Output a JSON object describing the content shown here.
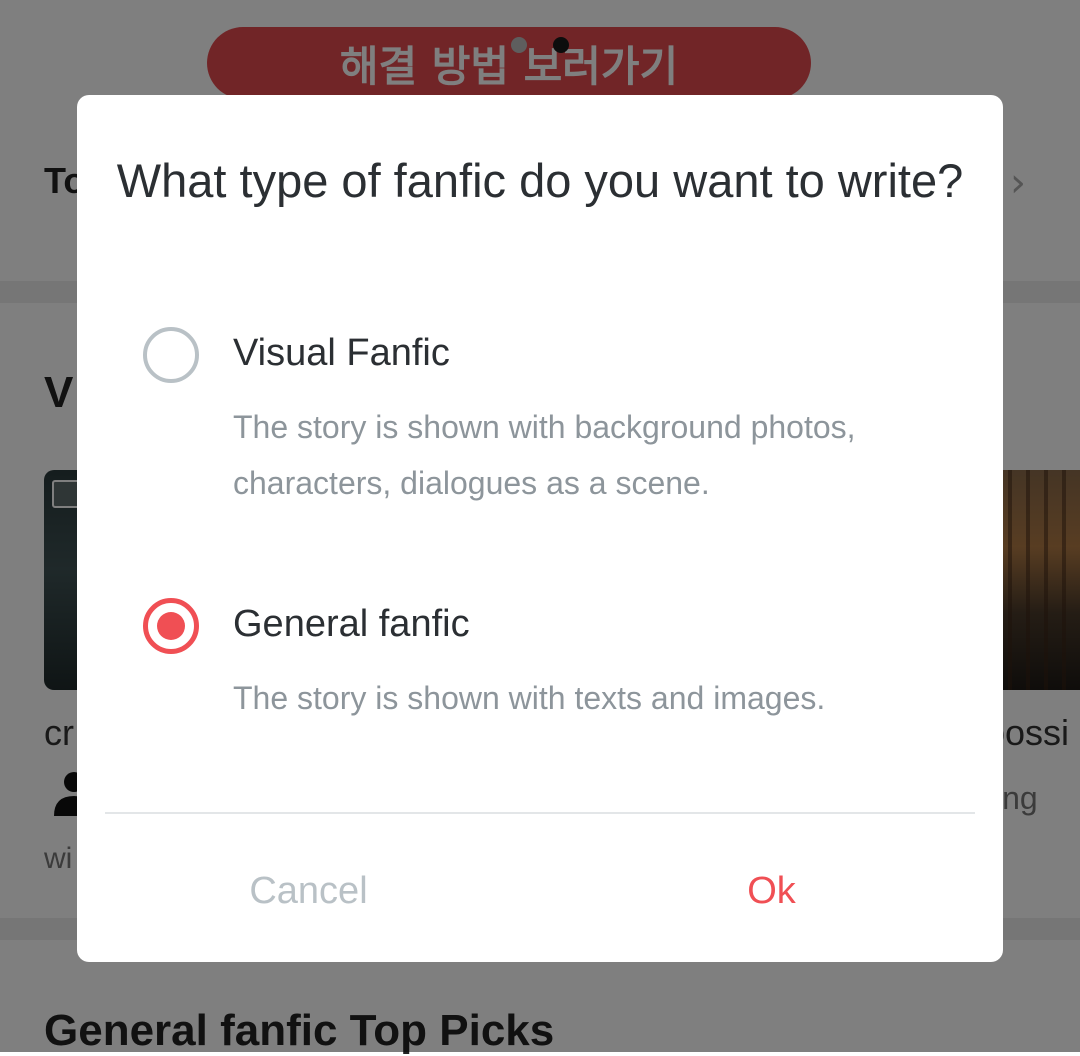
{
  "background": {
    "banner": {
      "label": "해결 방법 보러가기"
    },
    "row_label": "To",
    "row_chevron": "›",
    "section_title": "V",
    "card_left": {
      "title": "cr",
      "subtitle": "wi"
    },
    "card_right": {
      "title": "possi",
      "subtitle": "ing"
    },
    "bottom_section_title": "General fanfic Top Picks"
  },
  "dialog": {
    "title": "What type of fanfic do you want to write?",
    "options": [
      {
        "label": "Visual Fanfic",
        "description": "The story is shown with background photos, characters, dialogues as a scene.",
        "selected": false
      },
      {
        "label": "General fanfic",
        "description": "The story is shown with texts and images.",
        "selected": true
      }
    ],
    "cancel_label": "Cancel",
    "ok_label": "Ok"
  },
  "colors": {
    "accent": "#f04f54",
    "banner": "#e24a4f",
    "radio_off": "#b9c1c6",
    "text_primary": "#2b2f33",
    "text_secondary": "#8d959b"
  },
  "icons": {
    "radio_unselected": "radio-unselected-icon",
    "radio_selected": "radio-selected-icon",
    "chevron": "chevron-right-icon",
    "image_placeholder": "image-icon",
    "person": "person-icon"
  }
}
